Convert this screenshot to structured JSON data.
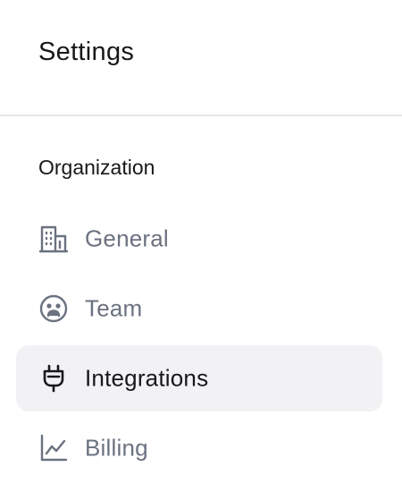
{
  "header": {
    "title": "Settings"
  },
  "section": {
    "label": "Organization"
  },
  "nav": {
    "items": [
      {
        "label": "General",
        "icon": "building-icon",
        "active": false
      },
      {
        "label": "Team",
        "icon": "face-icon",
        "active": false
      },
      {
        "label": "Integrations",
        "icon": "plug-icon",
        "active": true
      },
      {
        "label": "Billing",
        "icon": "line-chart-icon",
        "active": false
      }
    ]
  },
  "colors": {
    "text_primary": "#18181b",
    "text_muted": "#6b7280",
    "active_bg": "#f2f2f4",
    "divider": "#e5e7eb"
  }
}
